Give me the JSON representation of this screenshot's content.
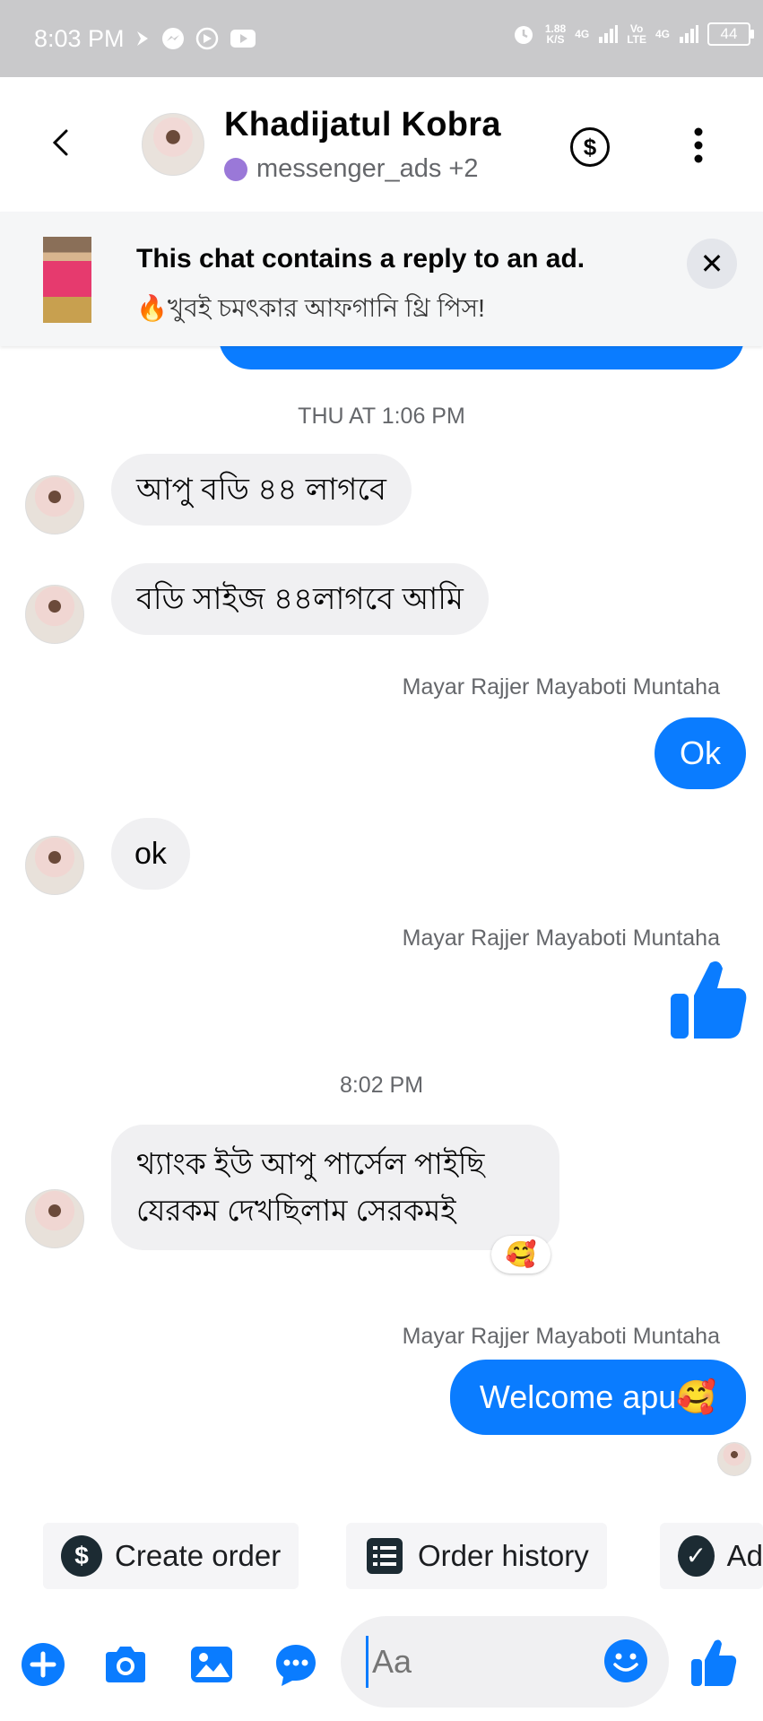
{
  "status_bar": {
    "time": "8:03 PM",
    "speed_top": "1.88",
    "speed_bottom": "K/S",
    "net1": "4G",
    "volte_top": "Vo",
    "volte_bottom": "LTE",
    "net2": "4G",
    "battery": "44"
  },
  "header": {
    "name": "Khadijatul Kobra",
    "subtitle": "messenger_ads +2"
  },
  "ad_banner": {
    "title": "This chat contains a reply to an ad.",
    "subtitle": "🔥খুবই চমৎকার আফগানি থ্রি পিস!"
  },
  "messages": {
    "ts1": "THU AT 1:06 PM",
    "m1": "আপু বডি ৪৪ লাগবে",
    "m2": "বডি সাইজ ৪৪লাগবে আমি",
    "sender": "Mayar Rajjer Mayaboti Muntaha",
    "m3": "Ok",
    "m4": "ok",
    "ts2": "8:02 PM",
    "m5_line1": "থ্যাংক ইউ আপু পার্সেল পাইছি",
    "m5_line2": "যেরকম দেখছিলাম সেরকমই",
    "m5_reaction": "🥰",
    "m6": "Welcome apu🥰"
  },
  "quick_actions": [
    {
      "label": "Create order",
      "icon": "dollar-icon"
    },
    {
      "label": "Order history",
      "icon": "list-icon"
    },
    {
      "label": "Ad",
      "icon": "check-icon"
    }
  ],
  "composer": {
    "placeholder": "Aa"
  },
  "colors": {
    "accent": "#0a7cff",
    "incoming_bubble": "#f0f0f2",
    "status_bar": "#c9c9cb"
  }
}
